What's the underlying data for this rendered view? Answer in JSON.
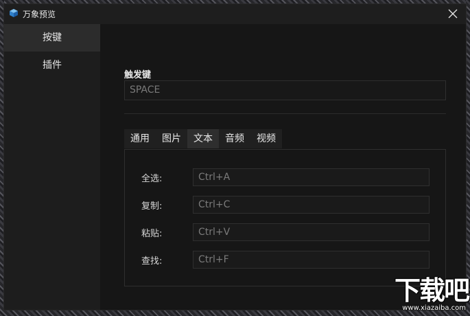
{
  "window": {
    "title": "万象预览"
  },
  "sidebar": {
    "items": [
      {
        "label": "按键",
        "active": true
      },
      {
        "label": "插件",
        "active": false
      }
    ]
  },
  "trigger": {
    "label": "触发键",
    "value": "SPACE"
  },
  "tabs": [
    {
      "label": "通用"
    },
    {
      "label": "图片"
    },
    {
      "label": "文本",
      "active": true
    },
    {
      "label": "音频"
    },
    {
      "label": "视频"
    }
  ],
  "shortcuts": [
    {
      "label": "全选:",
      "value": "Ctrl+A"
    },
    {
      "label": "复制:",
      "value": "Ctrl+C"
    },
    {
      "label": "粘贴:",
      "value": "Ctrl+V"
    },
    {
      "label": "查找:",
      "value": "Ctrl+F"
    }
  ],
  "watermark": {
    "main": "下载吧",
    "site": "www.xiazaiba.com"
  },
  "colors": {
    "accent": "#3b8fd8",
    "background": "#161616",
    "sidebar": "#1d1d1d"
  },
  "icons": {
    "app": "cube-logo-icon",
    "close": "close-icon"
  }
}
